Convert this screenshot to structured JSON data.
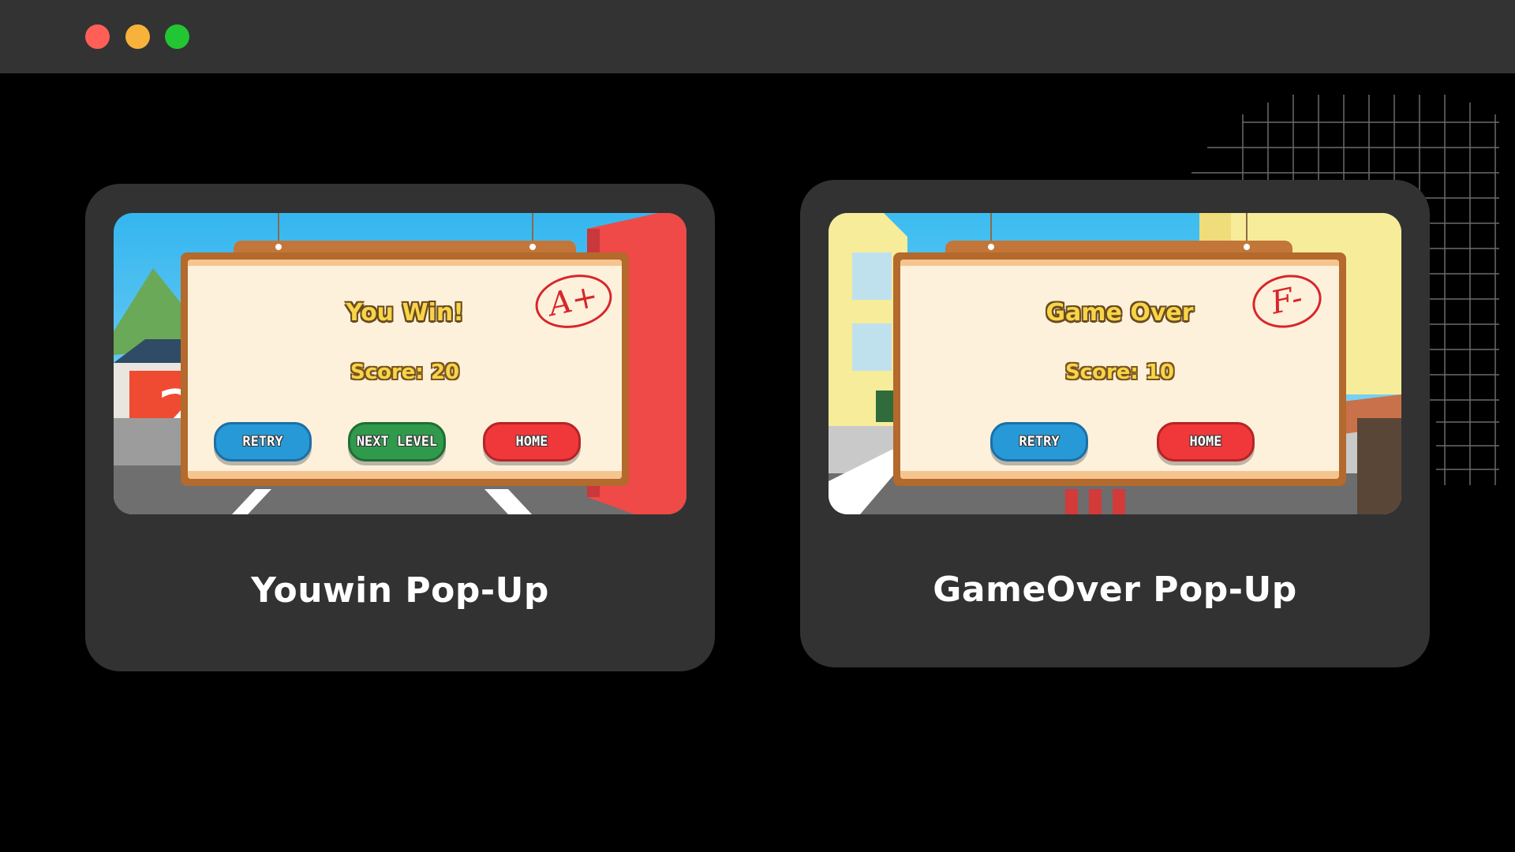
{
  "window": {
    "controls": [
      "close",
      "minimize",
      "maximize"
    ],
    "colors": {
      "close": "#ff5f57",
      "minimize": "#f6b23b",
      "maximize": "#22c532"
    }
  },
  "cards": [
    {
      "caption": "Youwin Pop-Up",
      "popup": {
        "title": "You Win!",
        "score": "Score: 20",
        "grade": "A+",
        "buttons": [
          "RETRY",
          "NEXT LEVEL",
          "HOME"
        ]
      },
      "scene_text": "2"
    },
    {
      "caption": "GameOver Pop-Up",
      "popup": {
        "title": "Game Over",
        "score": "Score: 10",
        "grade": "F-",
        "buttons": [
          "RETRY",
          "HOME"
        ]
      }
    }
  ]
}
